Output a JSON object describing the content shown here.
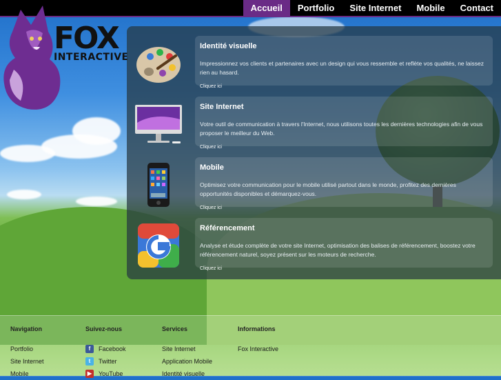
{
  "nav": {
    "items": [
      {
        "label": "Accueil",
        "active": true
      },
      {
        "label": "Portfolio",
        "active": false
      },
      {
        "label": "Site Internet",
        "active": false
      },
      {
        "label": "Mobile",
        "active": false
      },
      {
        "label": "Contact",
        "active": false
      }
    ],
    "accent_color": "#6a2b86"
  },
  "logo": {
    "word": "FOX",
    "sub": "INTERACTIVE",
    "icon": "fox-mascot-icon"
  },
  "services": [
    {
      "title": "Identité visuelle",
      "description": "Impressionnez vos clients et partenaires avec un design qui vous ressemble et reflète vos qualités, ne laissez rien au hasard.",
      "link": "Cliquez ici",
      "icon": "paint-palette-icon"
    },
    {
      "title": "Site Internet",
      "description": "Votre outil de communication à travers l'Internet, nous utilisons toutes les dernières technologies afin de vous proposer le meilleur du Web.",
      "link": "Cliquez ici",
      "icon": "imac-computer-icon"
    },
    {
      "title": "Mobile",
      "description": "Optimisez votre communication pour le mobile utilisé partout dans le monde, profitez des dernières opportunités disponibles et démarquez-vous.",
      "link": "Cliquez ici",
      "icon": "smartphone-icon"
    },
    {
      "title": "Référencement",
      "description": "Analyse et étude complète de votre site Internet, optimisation des balises de référencement, boostez votre référencement naturel, soyez présent sur les moteurs de recherche.",
      "link": "Cliquez ici",
      "icon": "google-g-icon"
    }
  ],
  "footer": {
    "navigation": {
      "heading": "Navigation",
      "links": [
        "Portfolio",
        "Site Internet",
        "Mobile"
      ]
    },
    "social": {
      "heading": "Suivez-nous",
      "links": [
        {
          "label": "Facebook",
          "icon": "facebook-icon",
          "color": "#3b5998"
        },
        {
          "label": "Twitter",
          "icon": "twitter-icon",
          "color": "#4ab3e6"
        },
        {
          "label": "YouTube",
          "icon": "youtube-icon",
          "color": "#c4302b"
        }
      ]
    },
    "services": {
      "heading": "Services",
      "links": [
        "Site Internet",
        "Application Mobile",
        "Identité visuelle"
      ]
    },
    "informations": {
      "heading": "Informations",
      "links": [
        "Fox Interactive"
      ]
    }
  }
}
